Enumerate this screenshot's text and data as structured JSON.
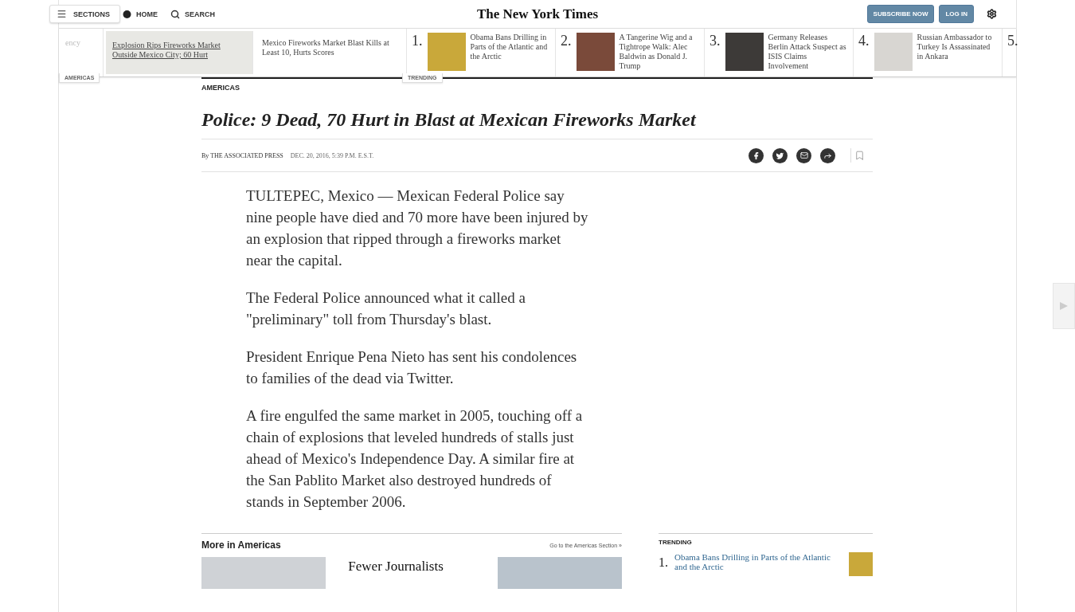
{
  "header": {
    "sections_label": "SECTIONS",
    "home_label": "HOME",
    "search_label": "SEARCH",
    "logo": "The New York Times",
    "subscribe": "SUBSCRIBE NOW",
    "login": "LOG IN"
  },
  "ribbon": {
    "section_tag": "AMERICAS",
    "trending_tag": "TRENDING",
    "section_items": [
      {
        "title": "ency",
        "selected": false
      },
      {
        "title": "Explosion Rips Fireworks Market Outside Mexico City; 60 Hurt",
        "selected": true
      },
      {
        "title": "Mexico Fireworks Market Blast Kills at Least 10, Hurts Scores",
        "selected": false
      }
    ],
    "trending_items": [
      {
        "rank": "1.",
        "title": "Obama Bans Drilling in Parts of the Atlantic and the Arctic",
        "color": "#c9a83a"
      },
      {
        "rank": "2.",
        "title": "A Tangerine Wig and a Tightrope Walk: Alec Baldwin as Donald J. Trump",
        "color": "#7a4a3a"
      },
      {
        "rank": "3.",
        "title": "Germany Releases Berlin Attack Suspect as ISIS Claims Involvement",
        "color": "#3d3a38"
      },
      {
        "rank": "4.",
        "title": "Russian Ambassador to Turkey Is Assassinated in Ankara",
        "color": "#d8d6d2"
      },
      {
        "rank": "5."
      }
    ]
  },
  "article": {
    "kicker": "AMERICAS",
    "headline": "Police: 9 Dead, 70 Hurt in Blast at Mexican Fireworks Market",
    "byline_prefix": "By",
    "author": "THE ASSOCIATED PRESS",
    "date": "DEC. 20, 2016, 5:39 P.M. E.S.T.",
    "paragraphs": [
      "TULTEPEC, Mexico — Mexican Federal Police say nine people have died and 70 more have been injured by an explosion that ripped through a fireworks market near the capital.",
      "The Federal Police announced what it called a \"preliminary\" toll from Thursday's blast.",
      "President Enrique Pena Nieto has sent his condolences to families of the dead via Twitter.",
      "A fire engulfed the same market in 2005, touching off a chain of explosions that leveled hundreds of stalls just ahead of Mexico's Independence Day. A similar fire at the San Pablito Market also destroyed hundreds of stands in September 2006."
    ]
  },
  "more": {
    "title": "More in Americas",
    "link": "Go to the Americas Section »",
    "headline": "Fewer Journalists"
  },
  "trending_box": {
    "title": "TRENDING",
    "items": [
      {
        "rank": "1.",
        "title": "Obama Bans Drilling in Parts of the Atlantic and the Arctic"
      }
    ]
  }
}
